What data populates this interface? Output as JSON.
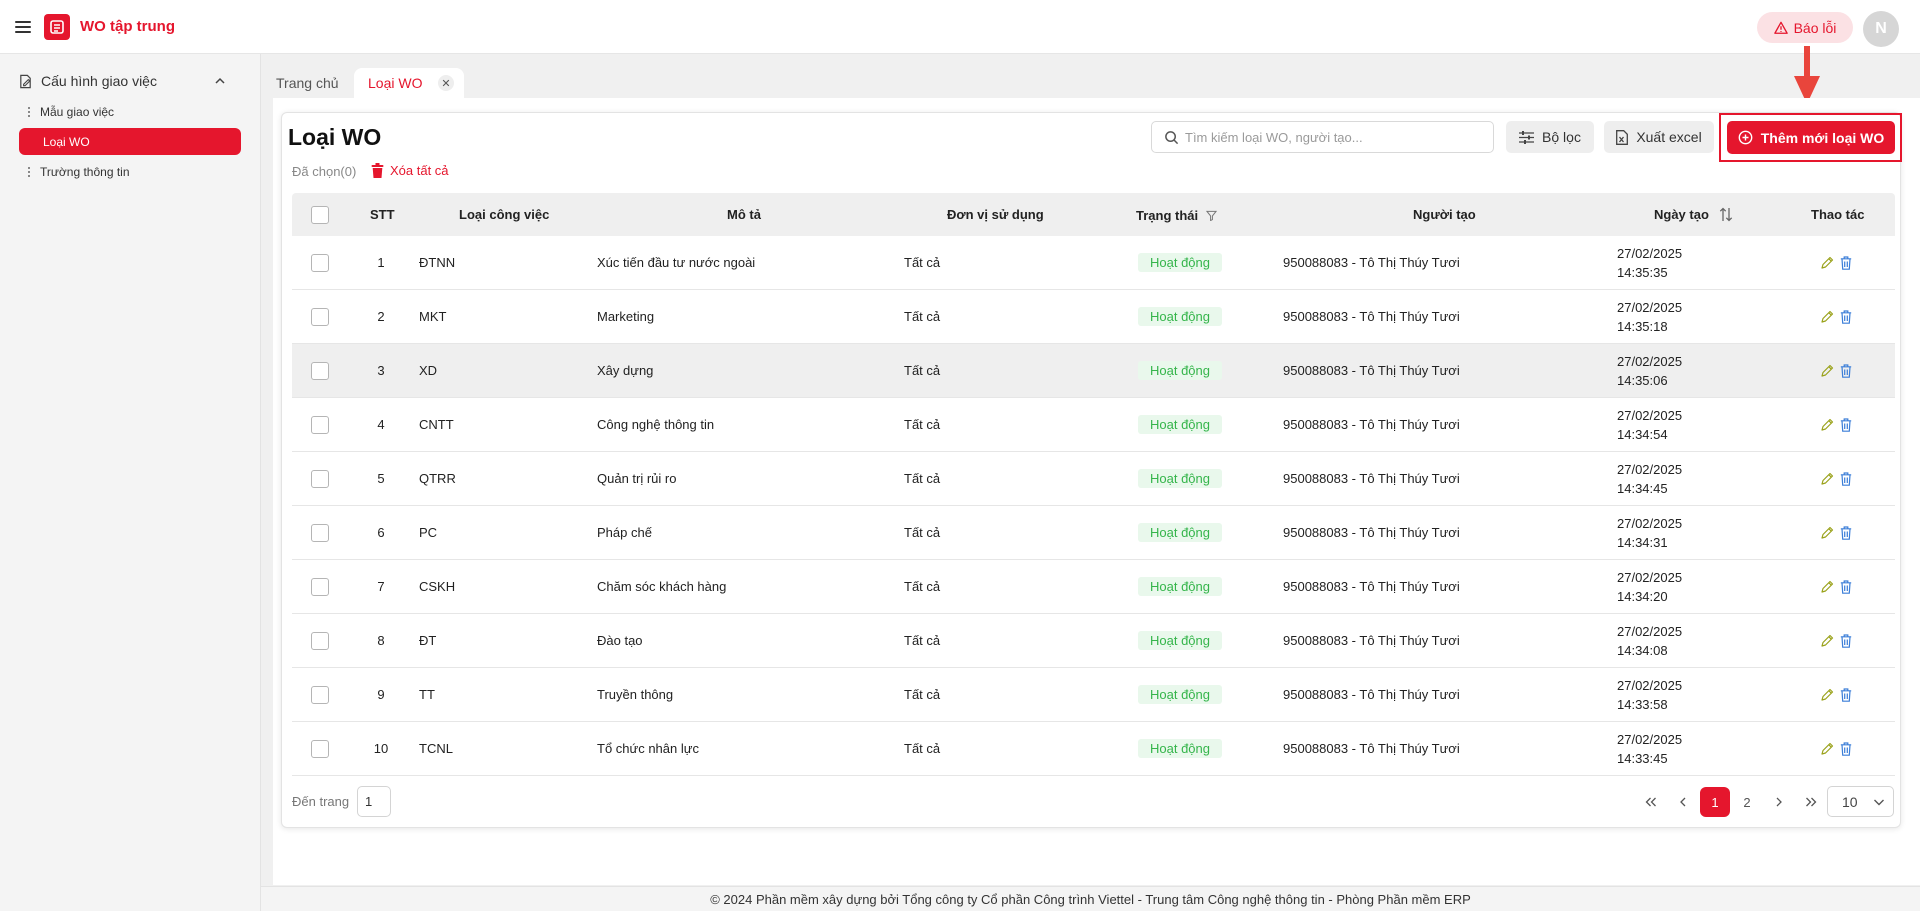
{
  "app": {
    "title": "WO tập trung",
    "report_label": "Báo lỗi",
    "avatar_initial": "N"
  },
  "colors": {
    "brand": "#e5162d",
    "status_active_bg": "#e9f8ec",
    "status_active_text": "#35b54b"
  },
  "sidebar": {
    "group_label": "Cấu hình giao việc",
    "items": [
      {
        "label": "Mẫu giao việc",
        "active": false
      },
      {
        "label": "Loại WO",
        "active": true
      },
      {
        "label": "Trường thông tin",
        "active": false
      }
    ]
  },
  "tabs": {
    "home": "Trang chủ",
    "active": "Loại WO"
  },
  "page": {
    "title": "Loại WO",
    "selected_label": "Đã chọn(0)",
    "delete_all_label": "Xóa tất cả",
    "search_placeholder": "Tìm kiếm loại WO, người tạo...",
    "filter_label": "Bộ lọc",
    "export_label": "Xuất excel",
    "add_label": "Thêm mới loại WO"
  },
  "table": {
    "headers": {
      "stt": "STT",
      "type": "Loại công việc",
      "desc": "Mô tả",
      "unit": "Đơn vị sử dụng",
      "status": "Trạng thái",
      "creator": "Người tạo",
      "date": "Ngày tạo",
      "actions": "Thao tác"
    },
    "rows": [
      {
        "stt": "1",
        "type": "ĐTNN",
        "desc": "Xúc tiến đầu tư nước ngoài",
        "unit": "Tất cả",
        "status": "Hoạt động",
        "creator": "950088083 - Tô Thị Thúy Tươi",
        "date": "27/02/2025",
        "time": "14:35:35"
      },
      {
        "stt": "2",
        "type": "MKT",
        "desc": "Marketing",
        "unit": "Tất cả",
        "status": "Hoạt động",
        "creator": "950088083 - Tô Thị Thúy Tươi",
        "date": "27/02/2025",
        "time": "14:35:18"
      },
      {
        "stt": "3",
        "type": "XD",
        "desc": "Xây dựng",
        "unit": "Tất cả",
        "status": "Hoạt động",
        "creator": "950088083 - Tô Thị Thúy Tươi",
        "date": "27/02/2025",
        "time": "14:35:06"
      },
      {
        "stt": "4",
        "type": "CNTT",
        "desc": "Công nghệ thông tin",
        "unit": "Tất cả",
        "status": "Hoạt động",
        "creator": "950088083 - Tô Thị Thúy Tươi",
        "date": "27/02/2025",
        "time": "14:34:54"
      },
      {
        "stt": "5",
        "type": "QTRR",
        "desc": "Quản trị rủi ro",
        "unit": "Tất cả",
        "status": "Hoạt động",
        "creator": "950088083 - Tô Thị Thúy Tươi",
        "date": "27/02/2025",
        "time": "14:34:45"
      },
      {
        "stt": "6",
        "type": "PC",
        "desc": "Pháp chế",
        "unit": "Tất cả",
        "status": "Hoạt động",
        "creator": "950088083 - Tô Thị Thúy Tươi",
        "date": "27/02/2025",
        "time": "14:34:31"
      },
      {
        "stt": "7",
        "type": "CSKH",
        "desc": "Chăm sóc khách hàng",
        "unit": "Tất cả",
        "status": "Hoạt động",
        "creator": "950088083 - Tô Thị Thúy Tươi",
        "date": "27/02/2025",
        "time": "14:34:20"
      },
      {
        "stt": "8",
        "type": "ĐT",
        "desc": "Đào tạo",
        "unit": "Tất cả",
        "status": "Hoạt động",
        "creator": "950088083 - Tô Thị Thúy Tươi",
        "date": "27/02/2025",
        "time": "14:34:08"
      },
      {
        "stt": "9",
        "type": "TT",
        "desc": "Truyền thông",
        "unit": "Tất cả",
        "status": "Hoạt động",
        "creator": "950088083 - Tô Thị Thúy Tươi",
        "date": "27/02/2025",
        "time": "14:33:58"
      },
      {
        "stt": "10",
        "type": "TCNL",
        "desc": "Tổ chức nhân lực",
        "unit": "Tất cả",
        "status": "Hoạt động",
        "creator": "950088083 - Tô Thị Thúy Tươi",
        "date": "27/02/2025",
        "time": "14:33:45"
      }
    ]
  },
  "pagination": {
    "goto_label": "Đến trang",
    "goto_value": "1",
    "pages": [
      "1",
      "2"
    ],
    "current_page": "1",
    "page_size": "10"
  },
  "footer": {
    "text": "© 2024 Phần mềm xây dựng bởi Tổng công ty Cổ phần Công trình Viettel - Trung tâm Công nghệ thông tin - Phòng Phần mềm ERP"
  }
}
